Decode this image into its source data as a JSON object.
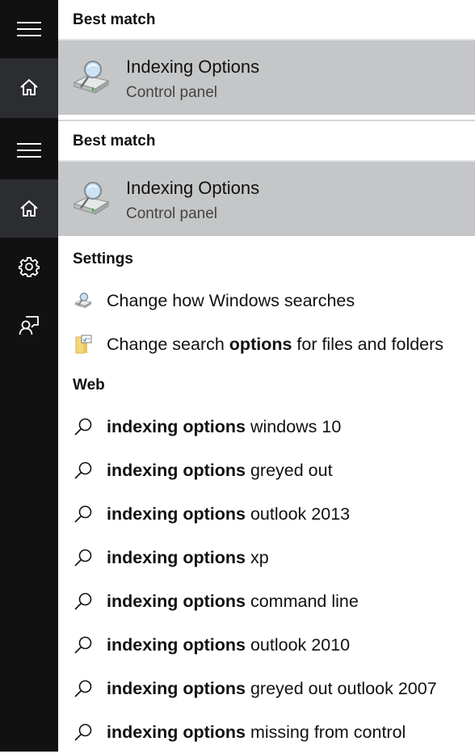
{
  "rail": {
    "items": [
      {
        "name": "menu",
        "icon": "hamburger-menu-icon"
      },
      {
        "name": "home",
        "icon": "home-icon",
        "active": true
      },
      {
        "name": "menu",
        "icon": "hamburger-menu-icon"
      },
      {
        "name": "home",
        "icon": "home-icon",
        "active": true
      },
      {
        "name": "settings",
        "icon": "gear-icon"
      },
      {
        "name": "feedback",
        "icon": "feedback-icon"
      }
    ]
  },
  "sections": {
    "best_match_1": "Best match",
    "best_match_2": "Best match",
    "settings": "Settings",
    "web": "Web"
  },
  "best_match": [
    {
      "title": "Indexing Options",
      "subtitle": "Control panel",
      "icon": "indexing-options-icon"
    },
    {
      "title": "Indexing Options",
      "subtitle": "Control panel",
      "icon": "indexing-options-icon"
    }
  ],
  "settings_items": [
    {
      "pre": "Change how Windows searches",
      "bold": "",
      "post": "",
      "icon": "indexing-options-icon"
    },
    {
      "pre": "Change search ",
      "bold": "options",
      "post": " for files and folders",
      "icon": "folder-options-icon"
    }
  ],
  "web_items": [
    {
      "bold": "indexing options",
      "rest": " windows 10"
    },
    {
      "bold": "indexing options",
      "rest": " greyed out"
    },
    {
      "bold": "indexing options",
      "rest": " outlook 2013"
    },
    {
      "bold": "indexing options",
      "rest": " xp"
    },
    {
      "bold": "indexing options",
      "rest": " command line"
    },
    {
      "bold": "indexing options",
      "rest": " outlook 2010"
    },
    {
      "bold": "indexing options",
      "rest": " greyed out outlook 2007"
    },
    {
      "bold": "indexing options",
      "rest": " missing from control"
    }
  ],
  "colors": {
    "rail_bg": "#111111",
    "rail_active": "#2b2d30",
    "selected_row": "#c4c6c7"
  }
}
